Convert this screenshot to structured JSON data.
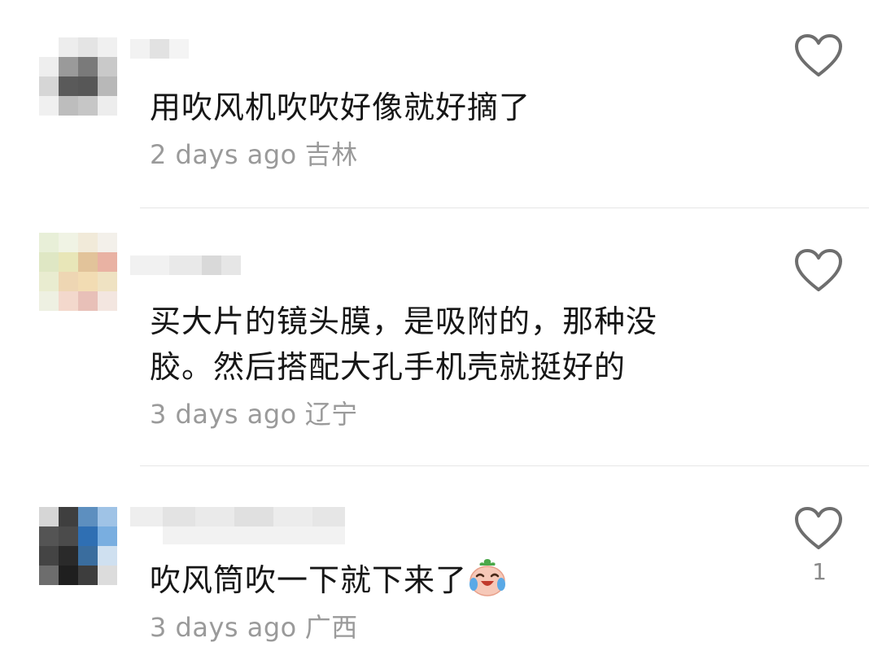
{
  "comments": [
    {
      "text": "用吹风机吹吹好像就好摘了",
      "time": "2 days ago",
      "location": "吉林",
      "likes": ""
    },
    {
      "text": "买大片的镜头膜，是吸附的，那种没胶。然后搭配大孔手机壳就挺好的",
      "time": "3 days ago",
      "location": "辽宁",
      "likes": ""
    },
    {
      "text": "吹风筒吹一下就下来了",
      "time": "3 days ago",
      "location": "广西",
      "likes": "1",
      "emoji": "laughing-crying-emoji"
    }
  ],
  "icons": {
    "like": "heart-outline-icon"
  },
  "colors": {
    "text": "#161616",
    "meta": "#9a9a9a",
    "divider": "#e6e6e6"
  }
}
